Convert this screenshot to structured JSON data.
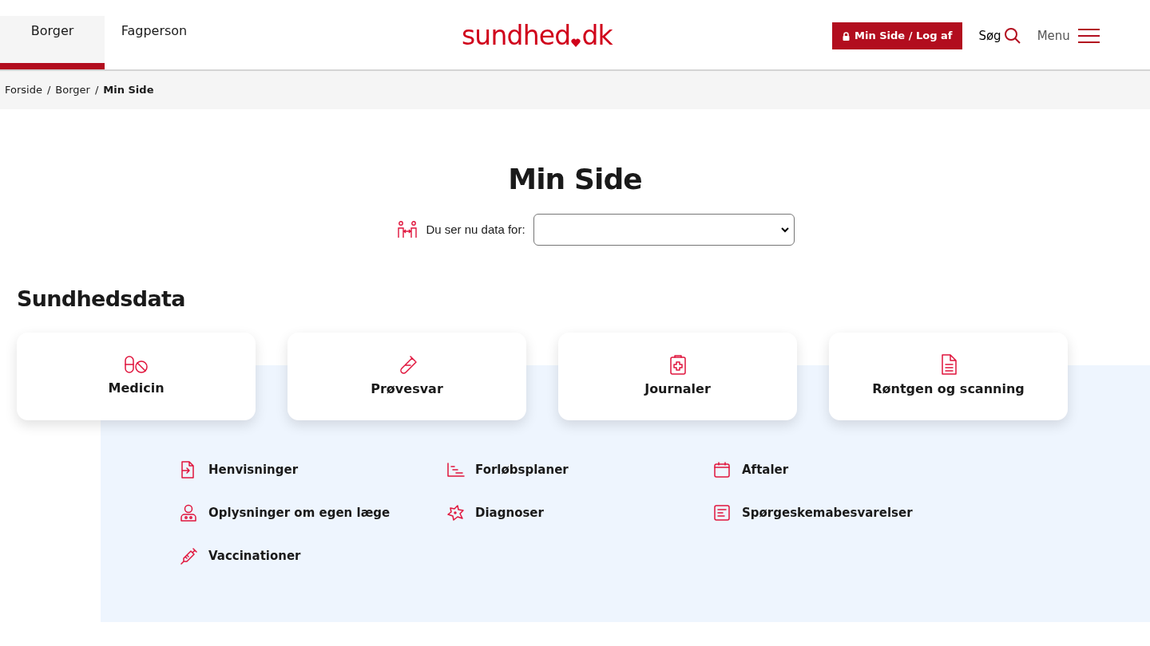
{
  "header": {
    "tabs": [
      {
        "label": "Borger",
        "selected": true
      },
      {
        "label": "Fagperson",
        "selected": false
      }
    ],
    "logo": {
      "name": "sundhed",
      "suffix": "dk"
    },
    "login_button": "Min Side / Log af",
    "search": "Søg",
    "menu": "Menu"
  },
  "breadcrumb": [
    {
      "label": "Forside",
      "current": false,
      "separator": "/"
    },
    {
      "label": "Borger",
      "current": false,
      "separator": "/"
    },
    {
      "label": "Min Side",
      "current": true
    }
  ],
  "page_title": "Min Side",
  "data_for": {
    "label": "Du ser nu data for:"
  },
  "section_title": "Sundhedsdata",
  "cards": [
    "Medicin",
    "Prøvesvar",
    "Journaler",
    "Røntgen og scanning"
  ],
  "links": [
    "Henvisninger",
    "Forløbsplaner",
    "Aftaler",
    "Oplysninger om egen læge",
    "Diagnoser",
    "Spørgeskemabesvarelser",
    "Vaccinationer"
  ]
}
